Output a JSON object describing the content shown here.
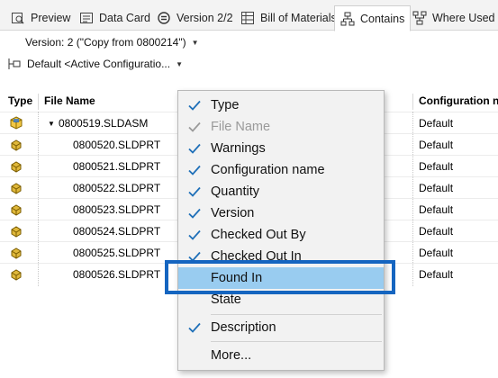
{
  "tabs": [
    {
      "label": "Preview",
      "icon": "preview-icon"
    },
    {
      "label": "Data Card",
      "icon": "data-card-icon"
    },
    {
      "label": "Version 2/2",
      "icon": "version-icon"
    },
    {
      "label": "Bill of Materials",
      "icon": "bom-icon"
    },
    {
      "label": "Contains",
      "icon": "contains-icon",
      "active": true
    },
    {
      "label": "Where Used",
      "icon": "where-used-icon"
    }
  ],
  "version_selector": {
    "value": "Version: 2 (\"Copy from 0800214\")"
  },
  "configuration_selector": {
    "value": "Default  <Active Configuratio..."
  },
  "grid": {
    "columns": {
      "type": "Type",
      "file_name": "File Name",
      "configuration": "Configuration n"
    },
    "rows": [
      {
        "file_name": "0800519.SLDASM",
        "configuration": "Default",
        "kind": "assembly",
        "expanded": true
      },
      {
        "file_name": "0800520.SLDPRT",
        "configuration": "Default",
        "kind": "part"
      },
      {
        "file_name": "0800521.SLDPRT",
        "configuration": "Default",
        "kind": "part"
      },
      {
        "file_name": "0800522.SLDPRT",
        "configuration": "Default",
        "kind": "part"
      },
      {
        "file_name": "0800523.SLDPRT",
        "configuration": "Default",
        "kind": "part"
      },
      {
        "file_name": "0800524.SLDPRT",
        "configuration": "Default",
        "kind": "part"
      },
      {
        "file_name": "0800525.SLDPRT",
        "configuration": "Default",
        "kind": "part"
      },
      {
        "file_name": "0800526.SLDPRT",
        "configuration": "Default",
        "kind": "part"
      }
    ]
  },
  "context_menu": {
    "items": [
      {
        "label": "Type",
        "checked": true,
        "disabled": false
      },
      {
        "label": "File Name",
        "checked": true,
        "disabled": true
      },
      {
        "label": "Warnings",
        "checked": true,
        "disabled": false
      },
      {
        "label": "Configuration name",
        "checked": true,
        "disabled": false
      },
      {
        "label": "Quantity",
        "checked": true,
        "disabled": false
      },
      {
        "label": "Version",
        "checked": true,
        "disabled": false
      },
      {
        "label": "Checked Out By",
        "checked": true,
        "disabled": false
      },
      {
        "label": "Checked Out In",
        "checked": true,
        "disabled": false
      },
      {
        "label": "Found In",
        "checked": false,
        "disabled": false,
        "highlighted": true
      },
      {
        "label": "State",
        "checked": false,
        "disabled": false
      },
      {
        "label": "Description",
        "checked": true,
        "disabled": false
      },
      {
        "label": "More...",
        "checked": false,
        "disabled": false
      }
    ]
  },
  "colors": {
    "accent": "#1565c0",
    "check": "#1e6fb8",
    "highlight": "#99ccf0",
    "part_icon": "#e0b83a"
  }
}
